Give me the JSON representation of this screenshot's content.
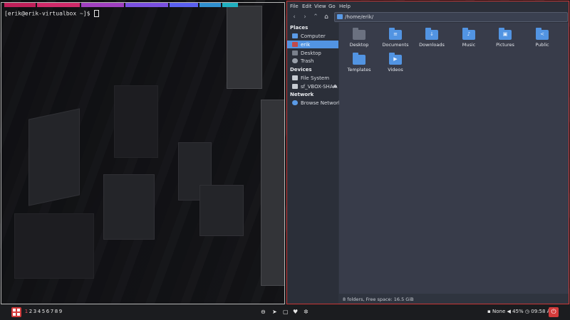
{
  "terminal": {
    "prompt": "[erik@erik-virtualbox ~]$ ",
    "top_bar_colors": [
      "#c0205a",
      "#d02a6a",
      "#a040c0",
      "#7a50e0",
      "#5a60f0",
      "#3090d0",
      "#20b0c0"
    ]
  },
  "file_manager": {
    "menu": [
      "File",
      "Edit",
      "View",
      "Go",
      "Help"
    ],
    "toolbar": {
      "back_icon": "chevron-left-icon",
      "forward_icon": "chevron-right-icon",
      "up_icon": "chevron-up-icon",
      "home_icon": "home-icon"
    },
    "location": "/home/erik/",
    "sidebar": {
      "places_heading": "Places",
      "places": [
        {
          "label": "Computer",
          "icon": "computer-icon",
          "selected": false
        },
        {
          "label": "erik",
          "icon": "home-folder-icon",
          "selected": true
        },
        {
          "label": "Desktop",
          "icon": "desktop-icon",
          "selected": false
        },
        {
          "label": "Trash",
          "icon": "trash-icon",
          "selected": false
        }
      ],
      "devices_heading": "Devices",
      "devices": [
        {
          "label": "File System",
          "icon": "drive-icon"
        },
        {
          "label": "sf_VBOX-SHA...",
          "icon": "drive-icon",
          "eject": "⏏"
        }
      ],
      "network_heading": "Network",
      "network": [
        {
          "label": "Browse Network",
          "icon": "network-icon"
        }
      ]
    },
    "folders": [
      {
        "label": "Desktop",
        "icon": "desktop-folder-icon",
        "glyph": ""
      },
      {
        "label": "Documents",
        "icon": "documents-folder-icon",
        "glyph": "≡"
      },
      {
        "label": "Downloads",
        "icon": "downloads-folder-icon",
        "glyph": "↓"
      },
      {
        "label": "Music",
        "icon": "music-folder-icon",
        "glyph": "♪"
      },
      {
        "label": "Pictures",
        "icon": "pictures-folder-icon",
        "glyph": "▣"
      },
      {
        "label": "Public",
        "icon": "public-folder-icon",
        "glyph": "<"
      },
      {
        "label": "Templates",
        "icon": "templates-folder-icon",
        "glyph": ""
      },
      {
        "label": "Videos",
        "icon": "videos-folder-icon",
        "glyph": "▶"
      }
    ],
    "status": "8 folders, Free space: 16.5 GiB"
  },
  "taskbar": {
    "workspaces": [
      "1",
      "2",
      "3",
      "4",
      "5",
      "6",
      "7",
      "8",
      "9"
    ],
    "active_workspace": "1",
    "tray": {
      "language": "None",
      "volume": "45%",
      "time": "09:58 AM"
    },
    "colors": {
      "accent": "#d43b3b"
    }
  }
}
